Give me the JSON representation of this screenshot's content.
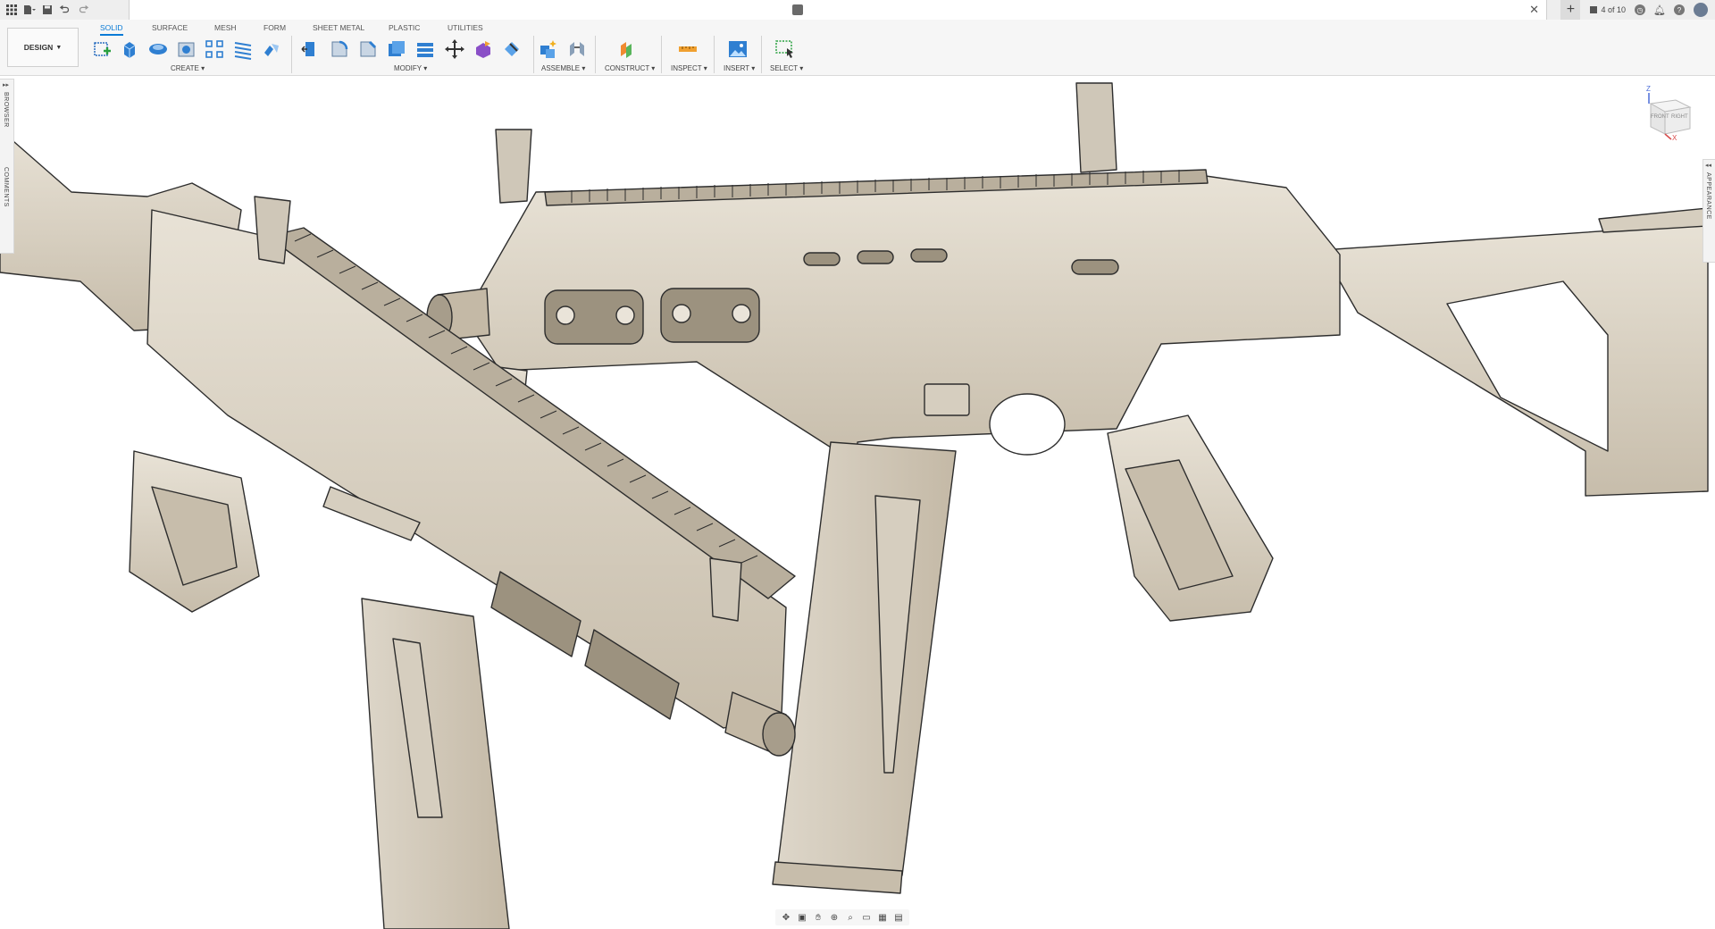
{
  "app": {
    "document_tab_title": "",
    "jobs_label": "4 of 10"
  },
  "workspace": {
    "label": "DESIGN"
  },
  "tabs": [
    {
      "label": "SOLID",
      "active": true
    },
    {
      "label": "SURFACE",
      "active": false
    },
    {
      "label": "MESH",
      "active": false
    },
    {
      "label": "FORM",
      "active": false
    },
    {
      "label": "SHEET METAL",
      "active": false
    },
    {
      "label": "PLASTIC",
      "active": false
    },
    {
      "label": "UTILITIES",
      "active": false
    }
  ],
  "groups": {
    "create": "CREATE",
    "modify": "MODIFY",
    "assemble": "ASSEMBLE",
    "construct": "CONSTRUCT",
    "inspect": "INSPECT",
    "insert": "INSERT",
    "select": "SELECT"
  },
  "panels": {
    "browser": "BROWSER",
    "comments": "COMMENTS",
    "appearance": "APPEARANCE"
  },
  "viewcube": {
    "front": "FRONT",
    "right": "RIGHT",
    "axis_z": "Z",
    "axis_x": "X"
  },
  "colors": {
    "accent": "#0a7bd6",
    "model": "#d9d1c3",
    "model_shadow": "#b8ae9d",
    "edge": "#2d2d2d"
  }
}
